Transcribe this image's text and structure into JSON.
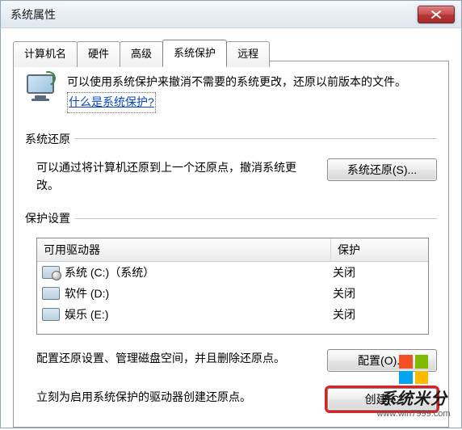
{
  "window": {
    "title": "系统属性"
  },
  "tabs": [
    {
      "label": "计算机名"
    },
    {
      "label": "硬件"
    },
    {
      "label": "高级"
    },
    {
      "label": "系统保护",
      "active": true
    },
    {
      "label": "远程"
    }
  ],
  "intro": {
    "text_before_link": "可以使用系统保护来撤消不需要的系统更改，还原以前版本的文件。",
    "link_text": "什么是系统保护?"
  },
  "restore": {
    "heading": "系统还原",
    "desc": "可以通过将计算机还原到上一个还原点，撤消系统更改。",
    "button": "系统还原(S)..."
  },
  "protection": {
    "heading": "保护设置",
    "columns": {
      "name": "可用驱动器",
      "protect": "保护"
    },
    "drives": [
      {
        "label": "系统 (C:)（系统）",
        "status": "关闭",
        "sys": true
      },
      {
        "label": "软件 (D:)",
        "status": "关闭",
        "sys": false
      },
      {
        "label": "娱乐 (E:)",
        "status": "关闭",
        "sys": false
      }
    ]
  },
  "configure": {
    "desc": "配置还原设置、管理磁盘空间，并且删除还原点。",
    "button": "配置(O)..."
  },
  "create": {
    "desc": "立刻为启用系统保护的驱动器创建还原点。",
    "button": "创建(C"
  },
  "watermark": {
    "brand": "系统米分",
    "url": "www.win7999.com"
  }
}
